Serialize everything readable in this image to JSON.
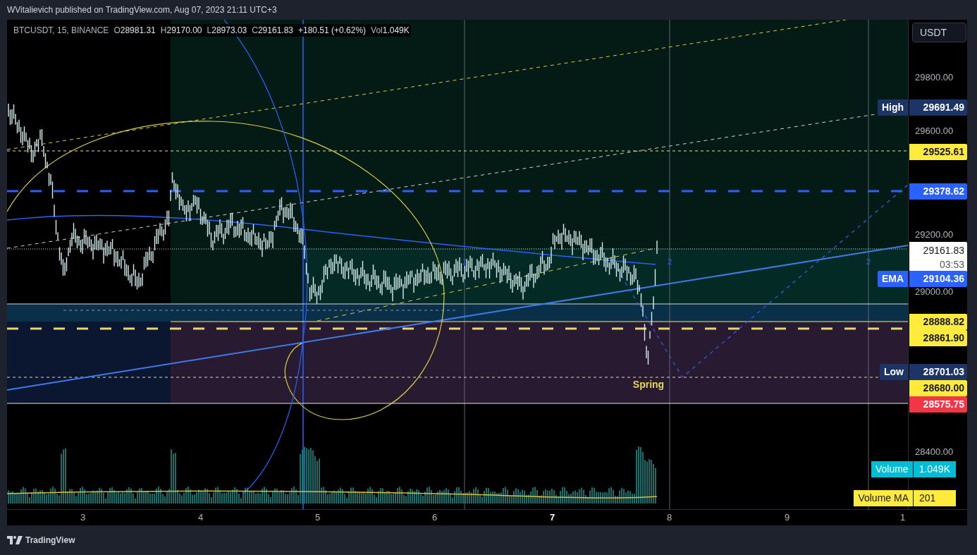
{
  "header": {
    "text": "WVitalievich published on TradingView.com, Aug 07, 2023 21:11 UTC+3"
  },
  "legend": {
    "symbol": "BTCUSDT, 15, BINANCE",
    "fields": [
      {
        "label": "O",
        "value": "28981.31"
      },
      {
        "label": "H",
        "value": "29170.00"
      },
      {
        "label": "L",
        "value": "28973.03"
      },
      {
        "label": "C",
        "value": "29161.83"
      }
    ],
    "change": "+180.51 (+0.62%)",
    "volume": {
      "label": "Vol",
      "value": "1.049K"
    }
  },
  "currency_button": "USDT",
  "price_axis": {
    "ticks": [
      "29800.00",
      "29600.00",
      "29200.00",
      "29000.00",
      "28400.00"
    ]
  },
  "price_tags": [
    {
      "label": "High",
      "value": "29691.49",
      "color": "#1c3466"
    },
    {
      "value": "29525.61",
      "color": "#ffeb3b"
    },
    {
      "value": "29378.62",
      "color": "#2962ff"
    },
    {
      "value": "29161.83",
      "sub": "03:53",
      "color": "#ffffff"
    },
    {
      "label": "EMA",
      "value": "29104.36",
      "color": "#2962ff"
    },
    {
      "value": "28888.82",
      "color": "#ffeb3b"
    },
    {
      "value": "28861.90",
      "color": "#ffeb3b"
    },
    {
      "label": "Low",
      "value": "28701.03",
      "color": "#1c3466"
    },
    {
      "value": "28680.00",
      "color": "#ffeb3b"
    },
    {
      "value": "28575.75",
      "color": "#f23645"
    }
  ],
  "indicator_tags": [
    {
      "label": "Volume",
      "value": "1.049K",
      "color": "#00bcd4"
    },
    {
      "label": "Volume MA",
      "value": "201",
      "color": "#ffeb3b"
    }
  ],
  "chart_labels": [
    {
      "text": "1"
    },
    {
      "text": "2"
    },
    {
      "text": "2"
    },
    {
      "text": "Spring"
    }
  ],
  "time_axis": [
    {
      "label": "3",
      "emphasized": false
    },
    {
      "label": "4",
      "emphasized": false
    },
    {
      "label": "5",
      "emphasized": false
    },
    {
      "label": "6",
      "emphasized": false
    },
    {
      "label": "7",
      "emphasized": true
    },
    {
      "label": "8",
      "emphasized": false
    },
    {
      "label": "9",
      "emphasized": false
    },
    {
      "label": "1",
      "emphasized": false
    }
  ],
  "footer": {
    "brand": "TradingView"
  }
}
